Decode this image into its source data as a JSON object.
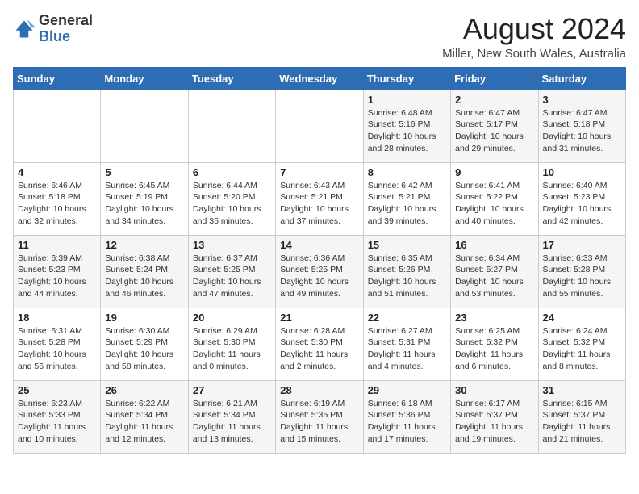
{
  "logo": {
    "general": "General",
    "blue": "Blue"
  },
  "header": {
    "month_year": "August 2024",
    "location": "Miller, New South Wales, Australia"
  },
  "weekdays": [
    "Sunday",
    "Monday",
    "Tuesday",
    "Wednesday",
    "Thursday",
    "Friday",
    "Saturday"
  ],
  "weeks": [
    [
      {
        "day": "",
        "info": ""
      },
      {
        "day": "",
        "info": ""
      },
      {
        "day": "",
        "info": ""
      },
      {
        "day": "",
        "info": ""
      },
      {
        "day": "1",
        "info": "Sunrise: 6:48 AM\nSunset: 5:16 PM\nDaylight: 10 hours\nand 28 minutes."
      },
      {
        "day": "2",
        "info": "Sunrise: 6:47 AM\nSunset: 5:17 PM\nDaylight: 10 hours\nand 29 minutes."
      },
      {
        "day": "3",
        "info": "Sunrise: 6:47 AM\nSunset: 5:18 PM\nDaylight: 10 hours\nand 31 minutes."
      }
    ],
    [
      {
        "day": "4",
        "info": "Sunrise: 6:46 AM\nSunset: 5:18 PM\nDaylight: 10 hours\nand 32 minutes."
      },
      {
        "day": "5",
        "info": "Sunrise: 6:45 AM\nSunset: 5:19 PM\nDaylight: 10 hours\nand 34 minutes."
      },
      {
        "day": "6",
        "info": "Sunrise: 6:44 AM\nSunset: 5:20 PM\nDaylight: 10 hours\nand 35 minutes."
      },
      {
        "day": "7",
        "info": "Sunrise: 6:43 AM\nSunset: 5:21 PM\nDaylight: 10 hours\nand 37 minutes."
      },
      {
        "day": "8",
        "info": "Sunrise: 6:42 AM\nSunset: 5:21 PM\nDaylight: 10 hours\nand 39 minutes."
      },
      {
        "day": "9",
        "info": "Sunrise: 6:41 AM\nSunset: 5:22 PM\nDaylight: 10 hours\nand 40 minutes."
      },
      {
        "day": "10",
        "info": "Sunrise: 6:40 AM\nSunset: 5:23 PM\nDaylight: 10 hours\nand 42 minutes."
      }
    ],
    [
      {
        "day": "11",
        "info": "Sunrise: 6:39 AM\nSunset: 5:23 PM\nDaylight: 10 hours\nand 44 minutes."
      },
      {
        "day": "12",
        "info": "Sunrise: 6:38 AM\nSunset: 5:24 PM\nDaylight: 10 hours\nand 46 minutes."
      },
      {
        "day": "13",
        "info": "Sunrise: 6:37 AM\nSunset: 5:25 PM\nDaylight: 10 hours\nand 47 minutes."
      },
      {
        "day": "14",
        "info": "Sunrise: 6:36 AM\nSunset: 5:25 PM\nDaylight: 10 hours\nand 49 minutes."
      },
      {
        "day": "15",
        "info": "Sunrise: 6:35 AM\nSunset: 5:26 PM\nDaylight: 10 hours\nand 51 minutes."
      },
      {
        "day": "16",
        "info": "Sunrise: 6:34 AM\nSunset: 5:27 PM\nDaylight: 10 hours\nand 53 minutes."
      },
      {
        "day": "17",
        "info": "Sunrise: 6:33 AM\nSunset: 5:28 PM\nDaylight: 10 hours\nand 55 minutes."
      }
    ],
    [
      {
        "day": "18",
        "info": "Sunrise: 6:31 AM\nSunset: 5:28 PM\nDaylight: 10 hours\nand 56 minutes."
      },
      {
        "day": "19",
        "info": "Sunrise: 6:30 AM\nSunset: 5:29 PM\nDaylight: 10 hours\nand 58 minutes."
      },
      {
        "day": "20",
        "info": "Sunrise: 6:29 AM\nSunset: 5:30 PM\nDaylight: 11 hours\nand 0 minutes."
      },
      {
        "day": "21",
        "info": "Sunrise: 6:28 AM\nSunset: 5:30 PM\nDaylight: 11 hours\nand 2 minutes."
      },
      {
        "day": "22",
        "info": "Sunrise: 6:27 AM\nSunset: 5:31 PM\nDaylight: 11 hours\nand 4 minutes."
      },
      {
        "day": "23",
        "info": "Sunrise: 6:25 AM\nSunset: 5:32 PM\nDaylight: 11 hours\nand 6 minutes."
      },
      {
        "day": "24",
        "info": "Sunrise: 6:24 AM\nSunset: 5:32 PM\nDaylight: 11 hours\nand 8 minutes."
      }
    ],
    [
      {
        "day": "25",
        "info": "Sunrise: 6:23 AM\nSunset: 5:33 PM\nDaylight: 11 hours\nand 10 minutes."
      },
      {
        "day": "26",
        "info": "Sunrise: 6:22 AM\nSunset: 5:34 PM\nDaylight: 11 hours\nand 12 minutes."
      },
      {
        "day": "27",
        "info": "Sunrise: 6:21 AM\nSunset: 5:34 PM\nDaylight: 11 hours\nand 13 minutes."
      },
      {
        "day": "28",
        "info": "Sunrise: 6:19 AM\nSunset: 5:35 PM\nDaylight: 11 hours\nand 15 minutes."
      },
      {
        "day": "29",
        "info": "Sunrise: 6:18 AM\nSunset: 5:36 PM\nDaylight: 11 hours\nand 17 minutes."
      },
      {
        "day": "30",
        "info": "Sunrise: 6:17 AM\nSunset: 5:37 PM\nDaylight: 11 hours\nand 19 minutes."
      },
      {
        "day": "31",
        "info": "Sunrise: 6:15 AM\nSunset: 5:37 PM\nDaylight: 11 hours\nand 21 minutes."
      }
    ]
  ]
}
